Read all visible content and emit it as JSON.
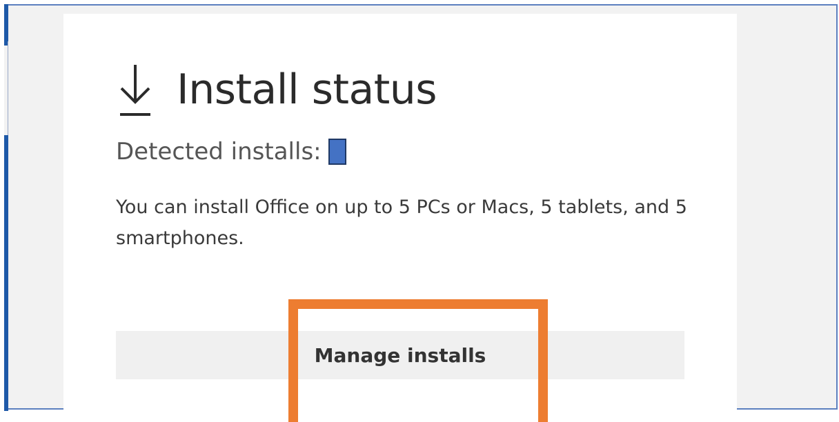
{
  "header": {
    "title": "Install status",
    "icon": "download-icon"
  },
  "detected": {
    "label": "Detected installs:",
    "count_redacted_color": "#4472c4"
  },
  "description": "You can install Office on up to 5 PCs or Macs, 5 tablets, and 5 smartphones.",
  "actions": {
    "manage_label": "Manage installs"
  },
  "colors": {
    "highlight": "#ed7d31",
    "accent": "#1f5aa8",
    "card_background": "#ffffff",
    "page_background": "#f2f2f2"
  }
}
